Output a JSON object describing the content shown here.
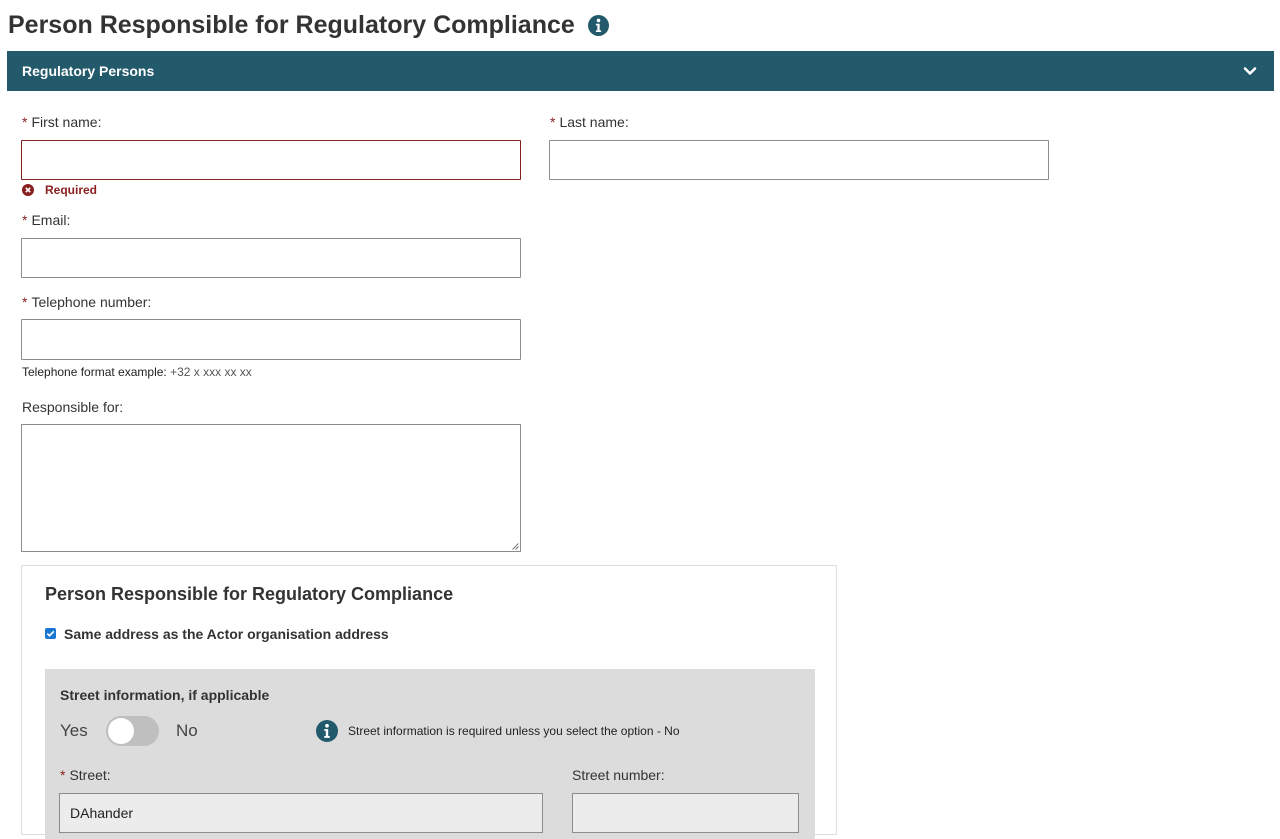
{
  "page": {
    "title": "Person Responsible for Regulatory Compliance",
    "title_icon": "info-circle-icon"
  },
  "panel": {
    "title": "Regulatory Persons",
    "toggle_icon": "chevron-down-icon",
    "header_color": "#22596b"
  },
  "form": {
    "required_marker": "*",
    "first_name": {
      "label": "First name:",
      "value": "",
      "error": "Required"
    },
    "last_name": {
      "label": "Last name:",
      "value": ""
    },
    "email": {
      "label": "Email:",
      "value": ""
    },
    "telephone": {
      "label": "Telephone number:",
      "value": "",
      "hint_prefix": "Telephone format example: ",
      "hint_example": "+32 x xxx xx xx"
    },
    "responsible_for": {
      "label": "Responsible for:",
      "value": ""
    }
  },
  "address": {
    "title": "Person Responsible for Regulatory Compliance",
    "same_address": {
      "label": "Same address as the Actor organisation address",
      "checked": true
    },
    "street_info": {
      "heading": "Street information, if applicable",
      "toggle_yes": "Yes",
      "toggle_no": "No",
      "info_icon": "info-circle-icon",
      "info_text": "Street information is required unless you select the option - No"
    },
    "street": {
      "label": "Street:",
      "value": "DAhander"
    },
    "street_number": {
      "label": "Street number:",
      "value": ""
    }
  },
  "colors": {
    "error": "#8a1f1f",
    "accent": "#22596b",
    "checkbox": "#1976d2"
  }
}
